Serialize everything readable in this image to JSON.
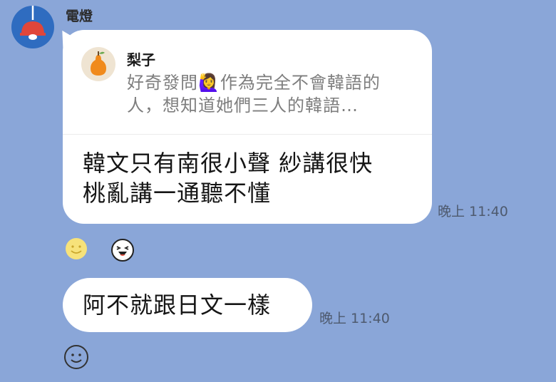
{
  "sender": {
    "name": "電燈",
    "avatar_icon": "ceiling-lamp-icon"
  },
  "message1": {
    "reply": {
      "author": "梨子",
      "author_avatar_icon": "pear-icon",
      "preview": "好奇發問🙋‍♀️作為完全不會韓語的人，想知道她們三人的韓語…"
    },
    "text_line1": "韓文只有南很小聲 紗講很快",
    "text_line2": "桃亂講一通聽不懂",
    "time": "晚上 11:40"
  },
  "reactions": [
    "smile-reaction-icon",
    "laughing-sticker-icon"
  ],
  "message2": {
    "text": "阿不就跟日文一樣",
    "time": "晚上 11:40"
  },
  "add_reaction_icon": "add-reaction-smile-icon",
  "colors": {
    "background": "#8aa6d8",
    "bubble": "#ffffff",
    "avatar_bg": "#2f6cc0",
    "lamp": "#e0463a"
  }
}
